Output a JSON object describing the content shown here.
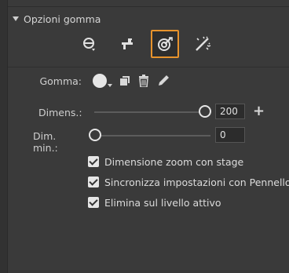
{
  "section": {
    "title": "Opzioni gomma"
  },
  "tools": [
    {
      "name": "faucet-erase-icon",
      "selected": false
    },
    {
      "name": "eraser-faucet-icon",
      "selected": false
    },
    {
      "name": "erase-strokes-icon",
      "selected": true
    },
    {
      "name": "eraser-magic-icon",
      "selected": false
    }
  ],
  "eraser": {
    "label": "Gomma:",
    "icons": [
      "brush-shape-icon",
      "square-shape-icon",
      "trash-icon",
      "pencil-icon"
    ]
  },
  "size": {
    "label": "Dimens.:",
    "value": "200"
  },
  "min_size": {
    "label": "Dim. min.:",
    "value": "0"
  },
  "options": [
    {
      "label": "Dimensione zoom con stage",
      "checked": true
    },
    {
      "label": "Sincronizza impostazioni con Pennello",
      "checked": true
    },
    {
      "label": "Elimina sul livello attivo",
      "checked": true
    }
  ],
  "colors": {
    "accent": "#e8932c",
    "panel": "#3a3a3a"
  }
}
